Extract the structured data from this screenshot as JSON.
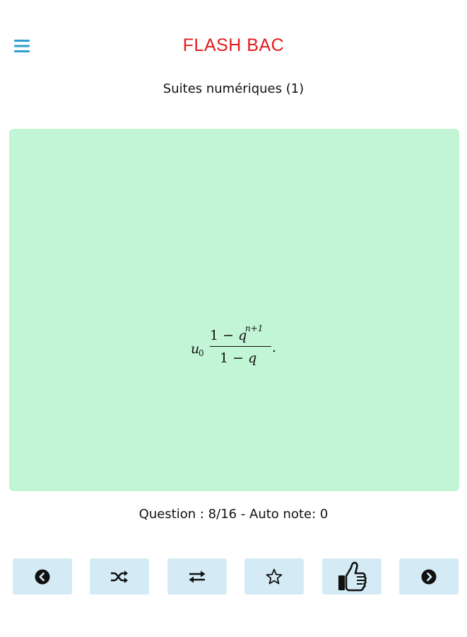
{
  "app": {
    "title": "FLASH BAC",
    "title_color": "#e31b1b"
  },
  "header": {
    "menu_icon": "menu-icon",
    "menu_icon_color": "#2a9fd0"
  },
  "deck": {
    "name": "Suites numériques (1)"
  },
  "card": {
    "background": "#c2f4d6",
    "formula": {
      "prefix": "u",
      "prefix_subscript": "0",
      "numerator_lead": "1 − ",
      "numerator_var": "q",
      "numerator_exponent": "n+1",
      "denominator_lead": "1 − ",
      "denominator_var": "q",
      "trailing": "."
    }
  },
  "status": {
    "text": "Question : 8/16 - Auto note: 0"
  },
  "toolbar": {
    "button_background": "#d4ebf5",
    "buttons": [
      {
        "name": "previous-button",
        "icon": "arrow-left-circle-icon"
      },
      {
        "name": "shuffle-button",
        "icon": "shuffle-icon"
      },
      {
        "name": "flip-button",
        "icon": "swap-arrows-icon"
      },
      {
        "name": "favorite-button",
        "icon": "star-outline-icon"
      },
      {
        "name": "thumbs-up-button",
        "icon": "thumbs-up-icon"
      },
      {
        "name": "next-button",
        "icon": "arrow-right-circle-icon"
      }
    ]
  }
}
